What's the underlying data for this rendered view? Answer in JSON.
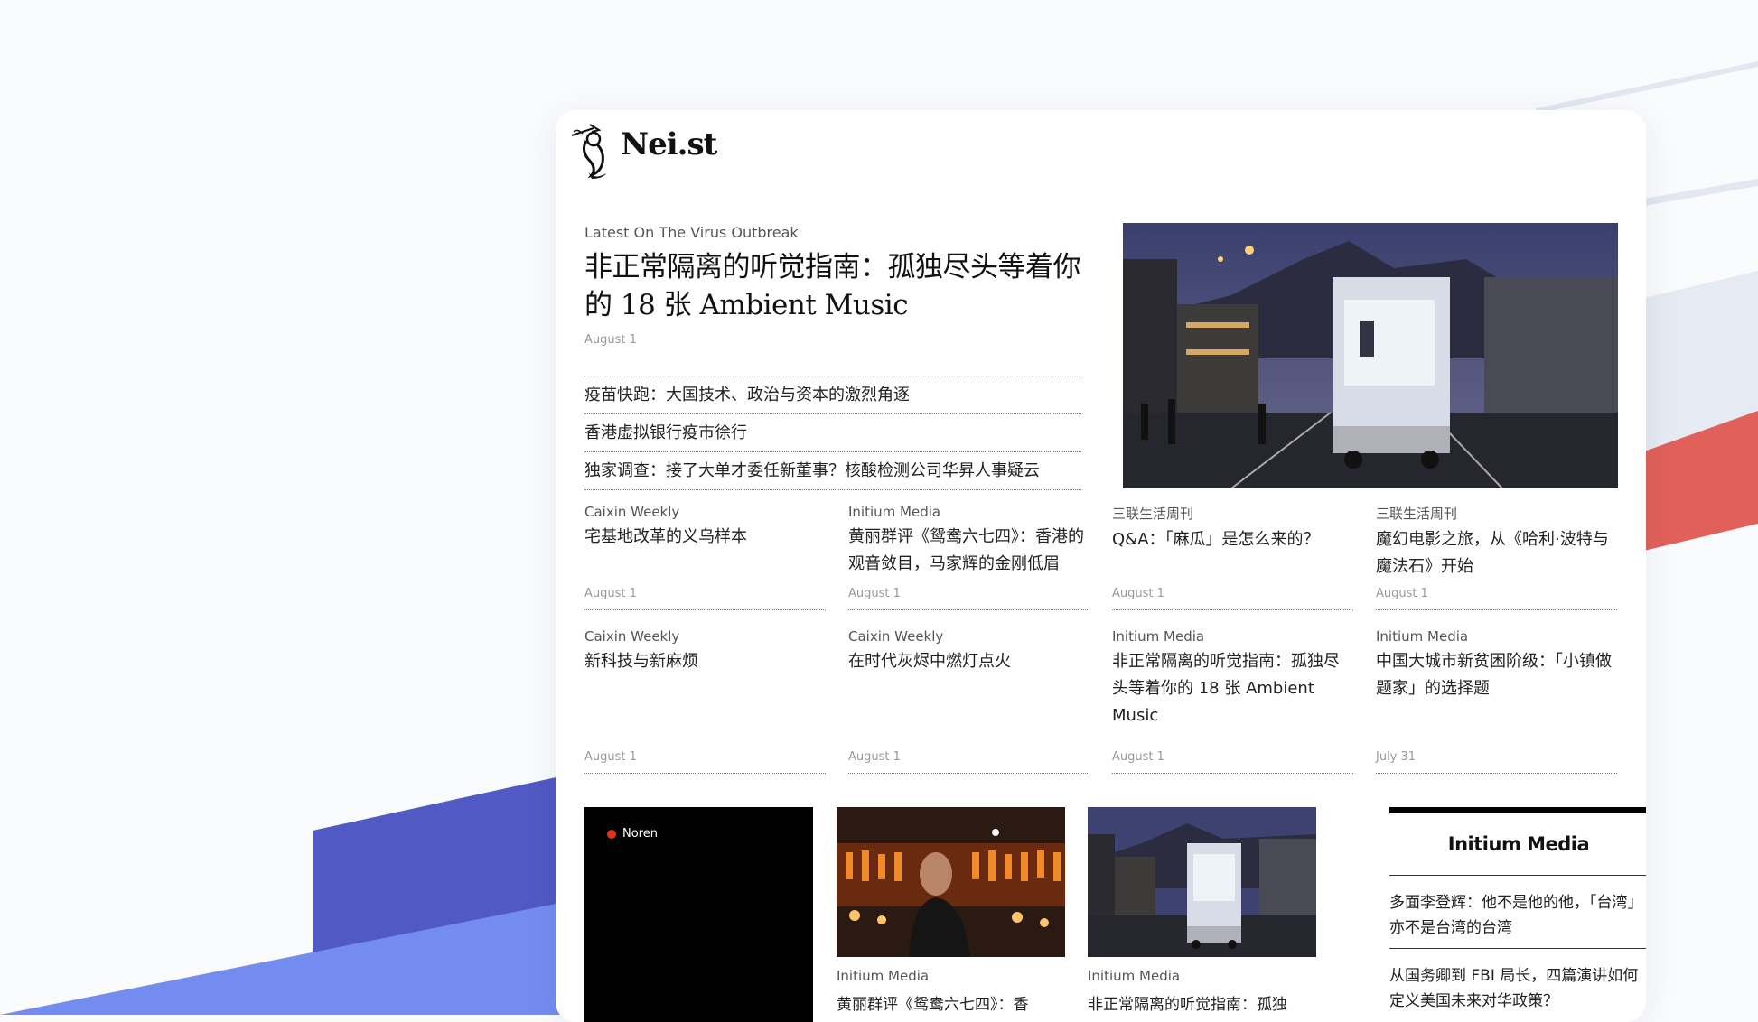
{
  "site": {
    "name": "Nei.st",
    "logo_icon": "siren-mermaid-icon"
  },
  "featured": {
    "kicker": "Latest On The Virus Outbreak",
    "title": "非正常隔离的听觉指南：孤独尽头等着你的 18 张 Ambient Music",
    "date": "August 1",
    "image": "night-street-booth-photo"
  },
  "headlines": [
    {
      "title": "疫苗快跑：大国技术、政治与资本的激烈角逐"
    },
    {
      "title": "香港虚拟银行疫市徐行"
    },
    {
      "title": "独家调查：接了大单才委任新董事？核酸检测公司华昇人事疑云"
    }
  ],
  "articles_row1": [
    {
      "source": "Caixin Weekly",
      "title": "宅基地改革的义乌样本",
      "date": "August 1"
    },
    {
      "source": "Initium Media",
      "title": "黄丽群评《鸳鸯六七四》：香港的观音敛目，马家辉的金刚低眉",
      "date": "August 1"
    },
    {
      "source": "三联生活周刊",
      "title": "Q&A：「麻瓜」是怎么来的？",
      "date": "August 1"
    },
    {
      "source": "三联生活周刊",
      "title": "魔幻电影之旅，从《哈利·波特与魔法石》开始",
      "date": "August 1"
    }
  ],
  "articles_row2": [
    {
      "source": "Caixin Weekly",
      "title": "新科技与新麻烦",
      "date": "August 1"
    },
    {
      "source": "Caixin Weekly",
      "title": "在时代灰烬中燃灯点火",
      "date": "August 1"
    },
    {
      "source": "Initium Media",
      "title": "非正常隔离的听觉指南：孤独尽头等着你的 18 张 Ambient Music",
      "date": "August 1"
    },
    {
      "source": "Initium Media",
      "title": "中国大城市新贫困阶级：「小镇做题家」的选择题",
      "date": "July 31"
    }
  ],
  "video": {
    "label": "Noren",
    "dot_color": "#e1331c"
  },
  "thumbnails": [
    {
      "source": "Initium Media",
      "title": "黄丽群评《鸳鸯六七四》：香",
      "image": "portrait-lanterns-photo"
    },
    {
      "source": "Initium Media",
      "title": "非正常隔离的听觉指南：孤独",
      "image": "night-street-booth-photo"
    }
  ],
  "sidebar": {
    "title": "Initium Media",
    "items": [
      {
        "title": "多面李登辉：他不是他的他，「台湾」亦不是台湾的台湾"
      },
      {
        "title": "从国务卿到 FBI 局长，四篇演讲如何定义美国未来对华政策？"
      }
    ]
  },
  "colors": {
    "accent_red": "#e1605a",
    "accent_indigo": "#5159c4",
    "accent_blue": "#748cf0"
  }
}
